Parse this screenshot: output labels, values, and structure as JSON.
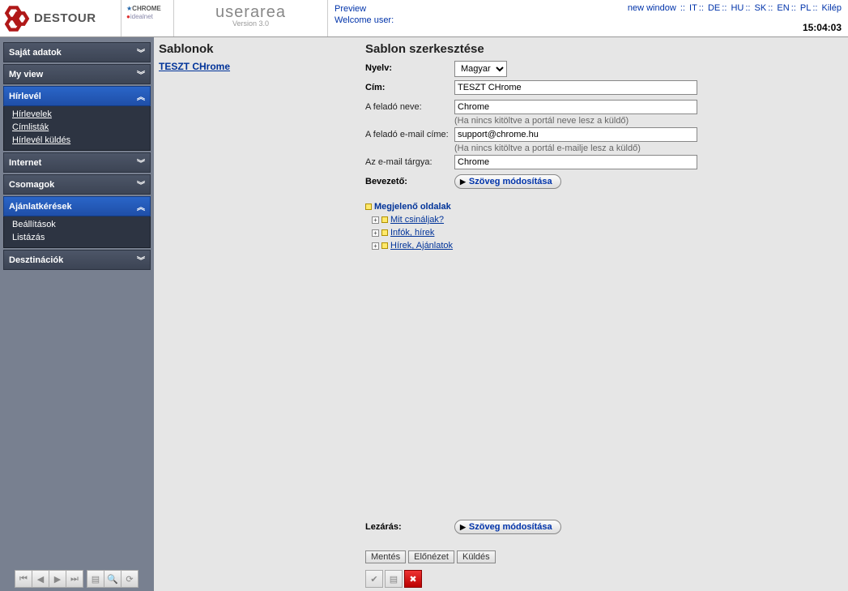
{
  "header": {
    "logo_text": "DESTOUR",
    "brand_chrome": "CHROME",
    "brand_ideal": "idealnet",
    "userarea": "userarea",
    "version": "Version 3.0",
    "preview": "Preview",
    "welcome": "Welcome user:",
    "new_window": "new window",
    "langs": [
      "IT",
      "DE",
      "HU",
      "SK",
      "EN",
      "PL"
    ],
    "logout": "Kilép",
    "clock": "15:04:03"
  },
  "sidebar": {
    "items": [
      {
        "label": "Saját adatok",
        "expanded": false,
        "children": []
      },
      {
        "label": "My view",
        "expanded": false,
        "children": []
      },
      {
        "label": "Hírlevél",
        "expanded": true,
        "active": true,
        "children": [
          "Hírlevelek",
          "Címlisták",
          "Hírlevél küldés"
        ]
      },
      {
        "label": "Internet",
        "expanded": false,
        "children": []
      },
      {
        "label": "Csomagok",
        "expanded": false,
        "children": []
      },
      {
        "label": "Ajánlatkérések",
        "expanded": true,
        "active": true,
        "children": [
          "Beállítások",
          "Listázás"
        ]
      },
      {
        "label": "Desztinációk",
        "expanded": false,
        "children": []
      }
    ]
  },
  "templates": {
    "heading": "Sablonok",
    "items": [
      "TESZT CHrome"
    ]
  },
  "editor": {
    "heading": "Sablon szerkesztése",
    "labels": {
      "language": "Nyelv:",
      "title": "Cím:",
      "sender_name": "A feladó neve:",
      "sender_email": "A feladó e-mail címe:",
      "subject": "Az e-mail tárgya:",
      "intro": "Bevezető:",
      "closing": "Lezárás:"
    },
    "language_options": [
      "Magyar"
    ],
    "language_selected": "Magyar",
    "title_value": "TESZT CHrome",
    "sender_name_value": "Chrome",
    "sender_name_hint": "(Ha nincs kitöltve a portál neve lesz a küldő)",
    "sender_email_value": "support@chrome.hu",
    "sender_email_hint": "(Ha nincs kitöltve a portál e-mailje lesz a küldő)",
    "subject_value": "Chrome",
    "modify_text_btn": "Szöveg módosítása",
    "tree": {
      "root": "Megjelenő oldalak",
      "children": [
        "Mit csináljak?",
        "Infók, hírek",
        "Hírek, Ajánlatok"
      ]
    },
    "buttons": {
      "save": "Mentés",
      "preview": "Előnézet",
      "send": "Küldés"
    }
  }
}
